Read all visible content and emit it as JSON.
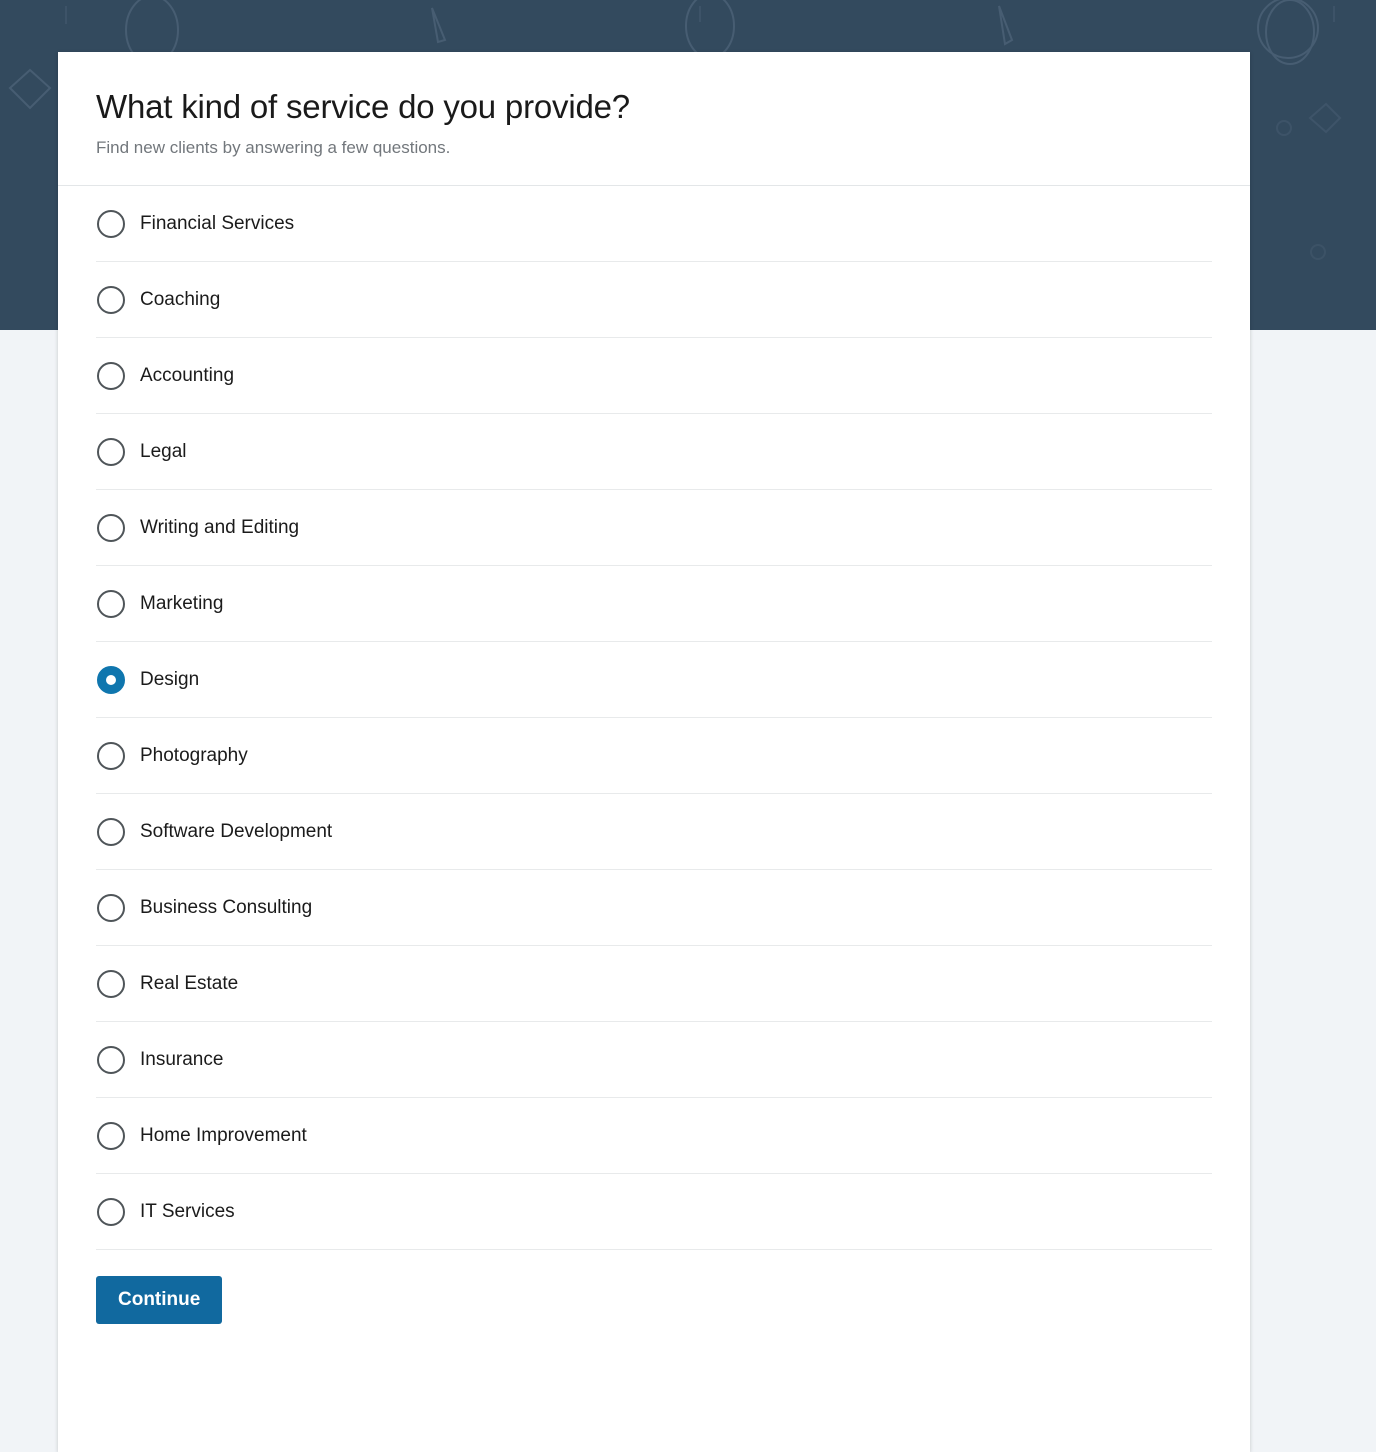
{
  "theme": {
    "hero_background": "#334a5e",
    "page_background": "#f1f4f7",
    "card_background": "#ffffff",
    "accent": "#0f76ae",
    "button_background": "#11699f",
    "divider": "#e8eaeb",
    "title_color": "#1a1a1a",
    "subtitle_color": "#72777c"
  },
  "card": {
    "title": "What kind of service do you provide?",
    "subtitle": "Find new clients by answering a few questions."
  },
  "options": [
    {
      "label": "Financial Services",
      "selected": false
    },
    {
      "label": "Coaching",
      "selected": false
    },
    {
      "label": "Accounting",
      "selected": false
    },
    {
      "label": "Legal",
      "selected": false
    },
    {
      "label": "Writing and Editing",
      "selected": false
    },
    {
      "label": "Marketing",
      "selected": false
    },
    {
      "label": "Design",
      "selected": true
    },
    {
      "label": "Photography",
      "selected": false
    },
    {
      "label": "Software Development",
      "selected": false
    },
    {
      "label": "Business Consulting",
      "selected": false
    },
    {
      "label": "Real Estate",
      "selected": false
    },
    {
      "label": "Insurance",
      "selected": false
    },
    {
      "label": "Home Improvement",
      "selected": false
    },
    {
      "label": "IT Services",
      "selected": false
    }
  ],
  "selected_option": "Design",
  "footer": {
    "continue_label": "Continue"
  }
}
